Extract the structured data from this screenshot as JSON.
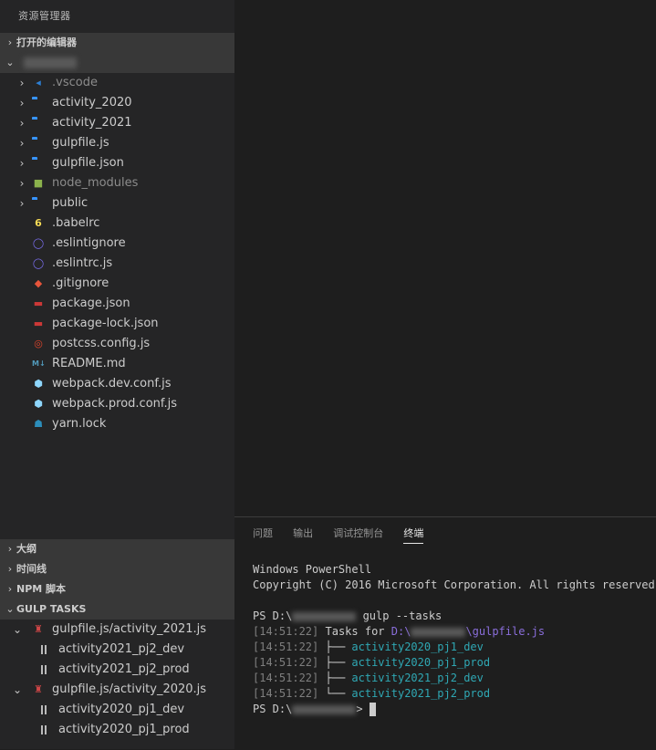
{
  "sidebar": {
    "title": "资源管理器",
    "open_editors": "打开的编辑器",
    "files": [
      {
        "name": ".vscode",
        "type": "folder",
        "icon": "vscode-icon",
        "color": "#2d7fd3",
        "dim": true
      },
      {
        "name": "activity_2020",
        "type": "folder",
        "icon": "folder-icon"
      },
      {
        "name": "activity_2021",
        "type": "folder",
        "icon": "folder-icon"
      },
      {
        "name": "gulpfile.js",
        "type": "folder",
        "icon": "folder-icon"
      },
      {
        "name": "gulpfile.json",
        "type": "folder",
        "icon": "folder-icon"
      },
      {
        "name": "node_modules",
        "type": "folder",
        "icon": "node-modules-icon",
        "color": "#8bb24c",
        "dim": true
      },
      {
        "name": "public",
        "type": "folder",
        "icon": "folder-icon"
      },
      {
        "name": ".babelrc",
        "type": "file",
        "icon": "babel-icon",
        "color": "#f5da55"
      },
      {
        "name": ".eslintignore",
        "type": "file",
        "icon": "eslint-icon",
        "color": "#7b6ff0"
      },
      {
        "name": ".eslintrc.js",
        "type": "file",
        "icon": "eslint-icon",
        "color": "#7b6ff0"
      },
      {
        "name": ".gitignore",
        "type": "file",
        "icon": "git-icon",
        "color": "#e8553b"
      },
      {
        "name": "package.json",
        "type": "file",
        "icon": "npm-icon",
        "color": "#cb3837"
      },
      {
        "name": "package-lock.json",
        "type": "file",
        "icon": "npm-icon",
        "color": "#cb3837"
      },
      {
        "name": "postcss.config.js",
        "type": "file",
        "icon": "postcss-icon",
        "color": "#e0442b"
      },
      {
        "name": "README.md",
        "type": "file",
        "icon": "markdown-icon",
        "color": "#519aba"
      },
      {
        "name": "webpack.dev.conf.js",
        "type": "file",
        "icon": "webpack-icon",
        "color": "#8ed6fb"
      },
      {
        "name": "webpack.prod.conf.js",
        "type": "file",
        "icon": "webpack-icon",
        "color": "#8ed6fb"
      },
      {
        "name": "yarn.lock",
        "type": "file",
        "icon": "yarn-icon",
        "color": "#2c8ebb"
      }
    ],
    "outline": "大纲",
    "timeline": "时间线",
    "npm_scripts": "NPM 脚本",
    "gulp_tasks": "GULP TASKS",
    "gulp_groups": [
      {
        "file": "gulpfile.js/activity_2021.js",
        "tasks": [
          "activity2021_pj2_dev",
          "activity2021_pj2_prod"
        ]
      },
      {
        "file": "gulpfile.js/activity_2020.js",
        "tasks": [
          "activity2020_pj1_dev",
          "activity2020_pj1_prod"
        ]
      }
    ]
  },
  "panel": {
    "tabs": [
      {
        "label": "问题",
        "active": false
      },
      {
        "label": "输出",
        "active": false
      },
      {
        "label": "调试控制台",
        "active": false
      },
      {
        "label": "终端",
        "active": true
      }
    ],
    "terminal": {
      "header1": "Windows PowerShell",
      "header2": "Copyright (C) 2016 Microsoft Corporation. All rights reserved.",
      "prompt": "PS D:\\",
      "command": " gulp --tasks",
      "time": "14:51:22",
      "tasks_for": " Tasks for ",
      "path_prefix": "D:\\",
      "path_suffix": "\\gulpfile.js",
      "tree_lines": [
        {
          "branch": " ├── ",
          "task": "activity2020_pj1_dev"
        },
        {
          "branch": " ├── ",
          "task": "activity2020_pj1_prod"
        },
        {
          "branch": " ├── ",
          "task": "activity2021_pj2_dev"
        },
        {
          "branch": " └── ",
          "task": "activity2021_pj2_prod"
        }
      ],
      "final_prompt": "PS D:\\",
      "final_suffix": "> "
    }
  }
}
